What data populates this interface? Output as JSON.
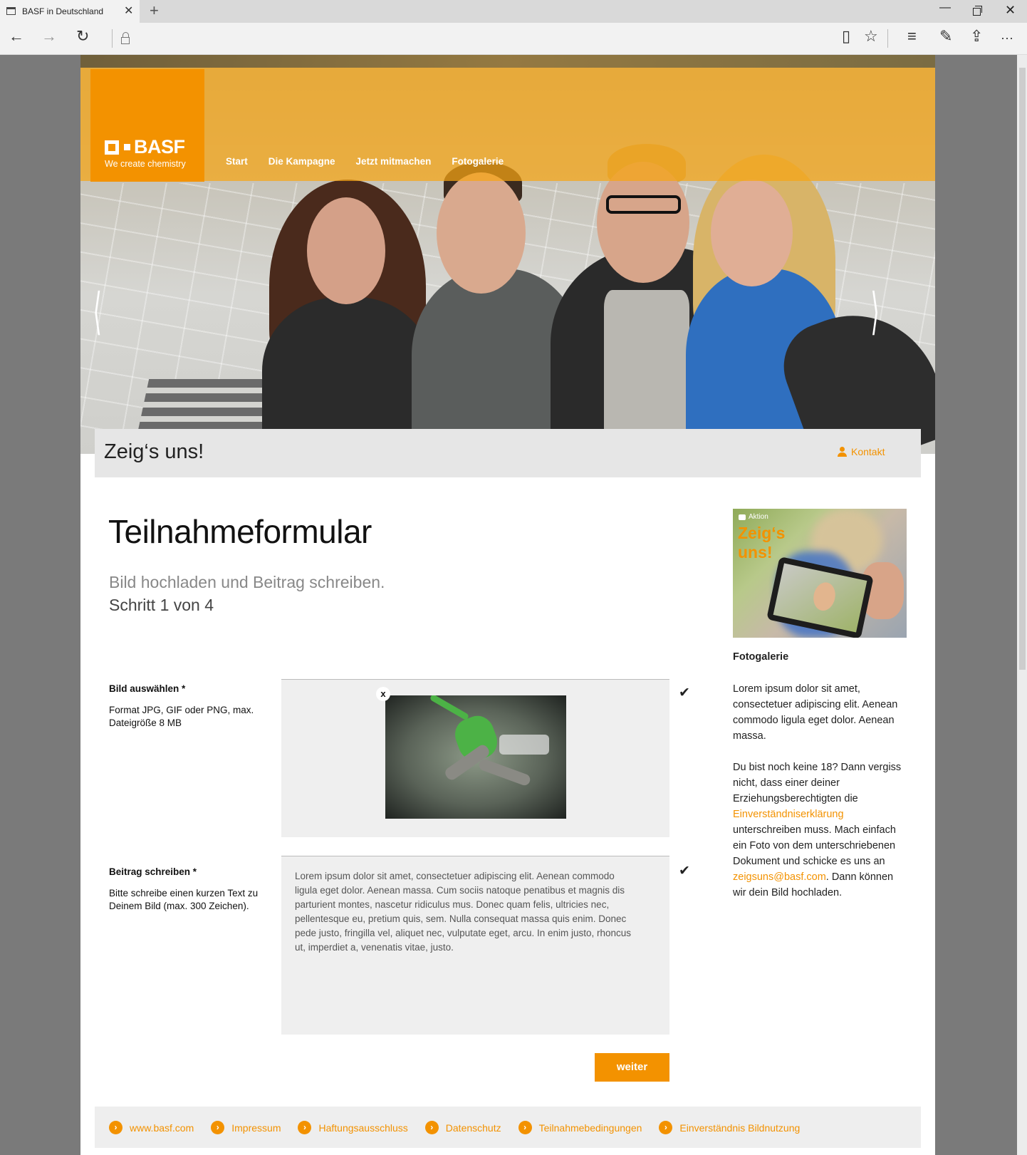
{
  "browser": {
    "tab_title": "BASF in Deutschland",
    "tab_close": "✕",
    "new_tab": "+",
    "win_minimize": "—",
    "win_close": "✕",
    "icons": [
      "back-icon",
      "forward-icon",
      "refresh-icon",
      "lock-icon",
      "reading-view-icon",
      "favorite-star-icon",
      "hub-icon",
      "web-note-icon",
      "share-icon",
      "more-icon"
    ],
    "back": "←",
    "forward": "→",
    "refresh": "↻",
    "reading": "▯",
    "star": "☆",
    "hub": "≡",
    "note": "✎",
    "share": "⇪",
    "more": "···"
  },
  "header": {
    "logo_text": "BASF",
    "logo_tagline": "We create chemistry",
    "nav": [
      "Start",
      "Die Kampagne",
      "Jetzt mitmachen",
      "Fotogalerie"
    ],
    "arrow_left": "⟨",
    "arrow_right": "⟩"
  },
  "titlebar": {
    "title": "Zeig‘s uns!",
    "contact": "Kontakt"
  },
  "form": {
    "heading": "Teilnahmeformular",
    "sub1": "Bild hochladen und Beitrag schreiben.",
    "sub2": "Schritt 1 von 4",
    "image_label": "Bild auswählen *",
    "image_help": "Format JPG, GIF oder PNG, max. Dateigröße 8 MB",
    "remove": "x",
    "text_label": "Beitrag schreiben *",
    "text_help": "Bitte schreibe einen kurzen Text zu Deinem Bild (max. 300 Zeichen).",
    "text_value": "Lorem ipsum dolor sit amet, consectetuer adipiscing elit. Aenean commodo ligula eget dolor. Aenean massa. Cum sociis natoque penatibus et magnis dis parturient montes, nascetur ridiculus mus. Donec quam felis, ultricies nec, pellentesque eu, pretium quis, sem. Nulla consequat massa quis enim. Donec pede justo, fringilla vel, aliquet nec, vulputate eget, arcu. In enim justo, rhoncus ut, imperdiet a, venenatis vitae, justo.",
    "check": "✔",
    "submit": "weiter"
  },
  "sidebar": {
    "teaser_tag": "Aktion",
    "teaser_title_1": "Zeig‘s",
    "teaser_title_2": "uns!",
    "heading": "Fotogalerie",
    "para1": "Lorem ipsum dolor sit amet, consectetuer adipiscing elit. Aenean commodo ligula eget dolor. Aenean massa.",
    "para2_a": "Du bist noch keine 18? Dann vergiss nicht, dass einer deiner Erziehungsberechtigten die ",
    "para2_link1": "Einverständniserklärung",
    "para2_b": " unterschreiben muss. Mach einfach ein Foto von dem unterschriebenen Dokument und schicke es uns an ",
    "para2_link2": "zeigsuns@basf.com",
    "para2_c": ". Dann können wir dein Bild hochladen."
  },
  "footer": {
    "icon": "›",
    "links": [
      "www.basf.com",
      "Impressum",
      "Haftungsausschluss",
      "Datenschutz",
      "Teilnahmebedingungen",
      "Einverständnis Bildnutzung"
    ]
  },
  "colors": {
    "accent": "#f39200",
    "chrome": "#f2f2f2",
    "page_bg": "#7a7a7a",
    "panel": "#efefef"
  }
}
